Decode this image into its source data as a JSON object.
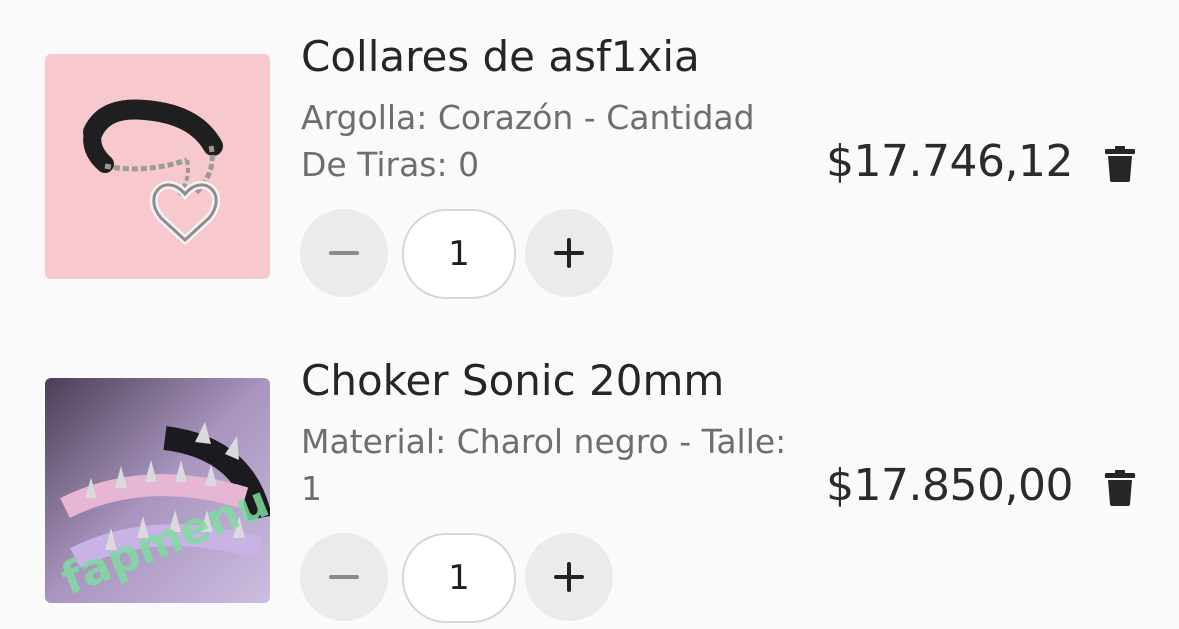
{
  "cart": {
    "items": [
      {
        "title": "Collares de asf1xia",
        "variant_line1": "Argolla: Corazón - Cantidad",
        "variant_line2": "De Tiras: 0",
        "price": "$17.746,12",
        "quantity": "1",
        "thumbnail_bg": "#f7c8ce"
      },
      {
        "title": "Choker Sonic 20mm",
        "variant_line1": "Material: Charol negro - Talle:",
        "variant_line2": "1",
        "price": "$17.850,00",
        "quantity": "1",
        "thumbnail_bg": "#b7a4c4"
      }
    ],
    "watermark": "fapmenu.com"
  },
  "icons": {
    "decrease": "minus-icon",
    "increase": "plus-icon",
    "delete": "trash-icon"
  },
  "colors": {
    "background": "#fafafa",
    "stepper_bg": "#ebebeb",
    "muted_text": "#6e6e6e",
    "watermark": "#7fdca0"
  }
}
